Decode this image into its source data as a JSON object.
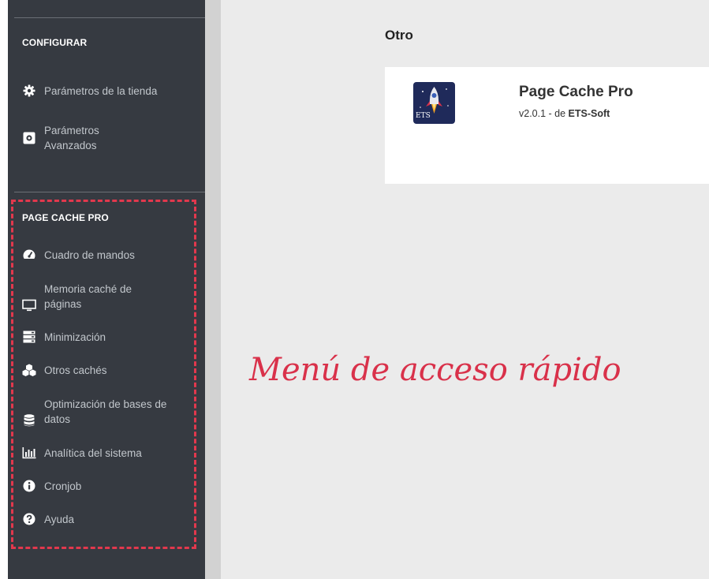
{
  "sidebar": {
    "configurar": {
      "title": "CONFIGURAR",
      "items": [
        {
          "label": "Parámetros de la tienda",
          "icon": "gear-icon"
        },
        {
          "label": "Parámetros Avanzados",
          "icon": "advanced-gear-icon"
        }
      ]
    },
    "page_cache": {
      "title": "PAGE CACHE PRO",
      "items": [
        {
          "label": "Cuadro de mandos",
          "icon": "dashboard-gauge-icon"
        },
        {
          "label": "Memoria caché de páginas",
          "icon": "monitor-icon"
        },
        {
          "label": "Minimización",
          "icon": "server-icon"
        },
        {
          "label": "Otros cachés",
          "icon": "cubes-icon"
        },
        {
          "label": "Optimización de bases de datos",
          "icon": "database-icon"
        },
        {
          "label": "Analítica del sistema",
          "icon": "bar-chart-icon"
        },
        {
          "label": "Cronjob",
          "icon": "info-circle-icon"
        },
        {
          "label": "Ayuda",
          "icon": "question-circle-icon"
        }
      ]
    }
  },
  "main": {
    "heading": "Otro",
    "module": {
      "name": "Page Cache Pro",
      "version_prefix": "v2.0.1 - de ",
      "author": "ETS-Soft",
      "logo_text": "ETS"
    }
  },
  "annotation": {
    "text": "Menú de acceso rápido",
    "color": "#d9314a"
  },
  "colors": {
    "sidebar_bg": "#363a41",
    "sidebar_text": "#c2c7cc",
    "content_bg": "#ebebeb",
    "highlight": "#e2384d"
  }
}
